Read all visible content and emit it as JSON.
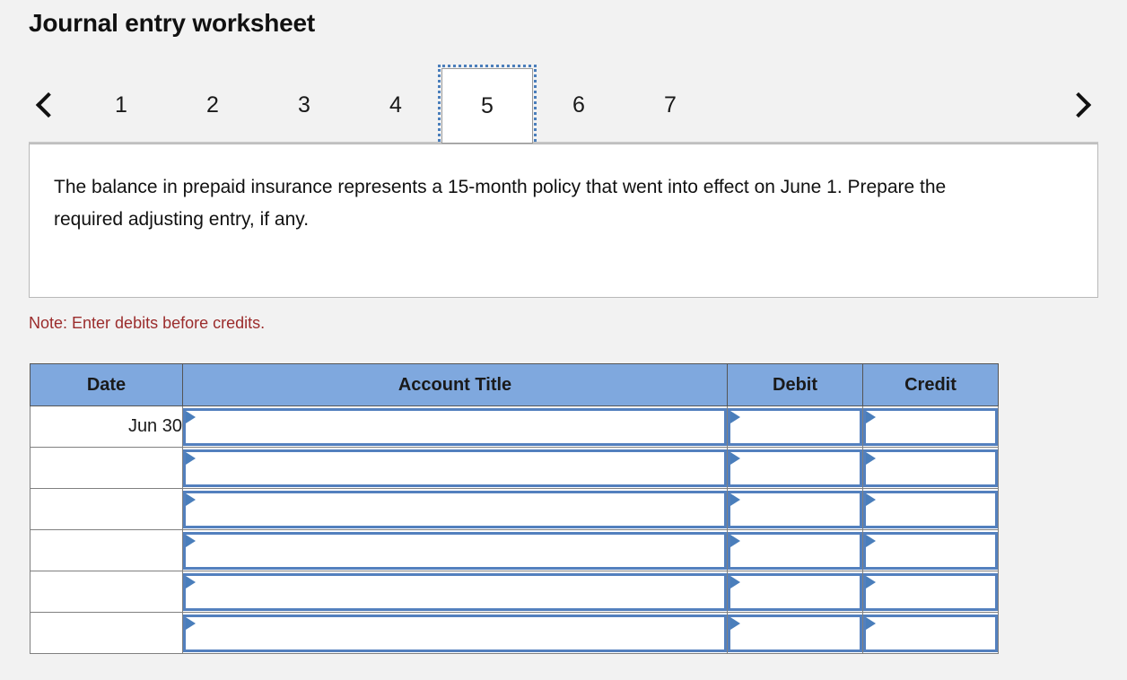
{
  "page": {
    "title": "Journal entry worksheet",
    "background_color": "#f2f2f2"
  },
  "pager": {
    "prev_icon": "chevron-left-icon",
    "next_icon": "chevron-right-icon",
    "prev_label": "‹",
    "next_label": "›",
    "selected": "5",
    "pages": [
      {
        "label": "1",
        "selected": false
      },
      {
        "label": "2",
        "selected": false
      },
      {
        "label": "3",
        "selected": false
      },
      {
        "label": "4",
        "selected": false
      },
      {
        "label": "5",
        "selected": true
      },
      {
        "label": "6",
        "selected": false
      },
      {
        "label": "7",
        "selected": false
      }
    ]
  },
  "instruction": {
    "text": "The balance in prepaid insurance represents a 15-month policy that went into effect on June 1. Prepare the required adjusting entry, if any."
  },
  "note": {
    "text": "Note: Enter debits before credits.",
    "color": "#9b2c2c"
  },
  "journal": {
    "columns": [
      {
        "key": "date",
        "label": "Date"
      },
      {
        "key": "account",
        "label": "Account Title"
      },
      {
        "key": "debit",
        "label": "Debit"
      },
      {
        "key": "credit",
        "label": "Credit"
      }
    ],
    "header_color": "#7fa8de",
    "input_border_color": "#5380be",
    "dropdown_icon": "dropdown-triangle-icon",
    "rows": [
      {
        "date": "Jun 30",
        "account": "",
        "debit": "",
        "credit": ""
      },
      {
        "date": "",
        "account": "",
        "debit": "",
        "credit": ""
      },
      {
        "date": "",
        "account": "",
        "debit": "",
        "credit": ""
      },
      {
        "date": "",
        "account": "",
        "debit": "",
        "credit": ""
      },
      {
        "date": "",
        "account": "",
        "debit": "",
        "credit": ""
      },
      {
        "date": "",
        "account": "",
        "debit": "",
        "credit": ""
      }
    ]
  }
}
